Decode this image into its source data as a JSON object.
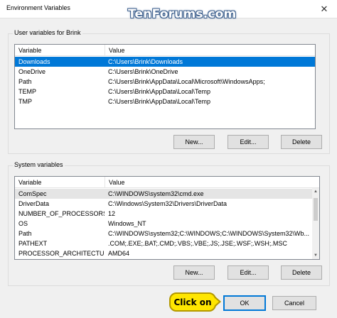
{
  "window": {
    "title": "Environment Variables",
    "close_glyph": "✕"
  },
  "watermark": "TenForums.com",
  "user_vars": {
    "group_label": "User variables for Brink",
    "columns": [
      "Variable",
      "Value"
    ],
    "rows": [
      {
        "name": "Downloads",
        "value": "C:\\Users\\Brink\\Downloads",
        "selected": true
      },
      {
        "name": "OneDrive",
        "value": "C:\\Users\\Brink\\OneDrive"
      },
      {
        "name": "Path",
        "value": "C:\\Users\\Brink\\AppData\\Local\\Microsoft\\WindowsApps;"
      },
      {
        "name": "TEMP",
        "value": "C:\\Users\\Brink\\AppData\\Local\\Temp"
      },
      {
        "name": "TMP",
        "value": "C:\\Users\\Brink\\AppData\\Local\\Temp"
      }
    ],
    "buttons": {
      "new": "New...",
      "edit": "Edit...",
      "delete": "Delete"
    }
  },
  "system_vars": {
    "group_label": "System variables",
    "columns": [
      "Variable",
      "Value"
    ],
    "rows": [
      {
        "name": "ComSpec",
        "value": "C:\\WINDOWS\\system32\\cmd.exe"
      },
      {
        "name": "DriverData",
        "value": "C:\\Windows\\System32\\Drivers\\DriverData"
      },
      {
        "name": "NUMBER_OF_PROCESSORS",
        "value": "12"
      },
      {
        "name": "OS",
        "value": "Windows_NT"
      },
      {
        "name": "Path",
        "value": "C:\\WINDOWS\\system32;C:\\WINDOWS;C:\\WINDOWS\\System32\\Wb..."
      },
      {
        "name": "PATHEXT",
        "value": ".COM;.EXE;.BAT;.CMD;.VBS;.VBE;.JS;.JSE;.WSF;.WSH;.MSC"
      },
      {
        "name": "PROCESSOR_ARCHITECTURE",
        "value": "AMD64"
      }
    ],
    "buttons": {
      "new": "New...",
      "edit": "Edit...",
      "delete": "Delete"
    }
  },
  "dialog_buttons": {
    "ok": "OK",
    "cancel": "Cancel"
  },
  "callout": "Click on",
  "colors": {
    "selection": "#0078d7",
    "callout": "#ffe600"
  }
}
